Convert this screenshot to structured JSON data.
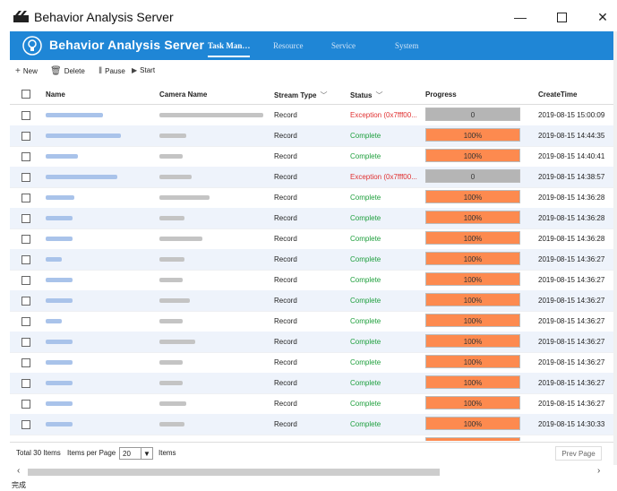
{
  "window": {
    "title": "Behavior Analysis Server"
  },
  "header": {
    "app_name": "Behavior Analysis Server",
    "tabs": [
      {
        "label": "Task Man…",
        "active": true
      },
      {
        "label": "Resource",
        "active": false
      },
      {
        "label": "Service",
        "active": false
      },
      {
        "label": "System",
        "active": false
      }
    ]
  },
  "toolbar": {
    "new_label": "New",
    "delete_label": "Delete",
    "pause_label": "Pause",
    "start_label": "Start"
  },
  "table": {
    "columns": [
      "Name",
      "Camera Name",
      "Stream Type",
      "Status",
      "Progress",
      "CreateTime"
    ],
    "rows": [
      {
        "stream": "Record",
        "status": "Exception (0x7fff00...",
        "status_type": "error",
        "progress": "0",
        "time": "2019-08-15 15:00:09"
      },
      {
        "stream": "Record",
        "status": "Complete",
        "status_type": "ok",
        "progress": "100%",
        "time": "2019-08-15 14:44:35"
      },
      {
        "stream": "Record",
        "status": "Complete",
        "status_type": "ok",
        "progress": "100%",
        "time": "2019-08-15 14:40:41"
      },
      {
        "stream": "Record",
        "status": "Exception (0x7fff00...",
        "status_type": "error",
        "progress": "0",
        "time": "2019-08-15 14:38:57"
      },
      {
        "stream": "Record",
        "status": "Complete",
        "status_type": "ok",
        "progress": "100%",
        "time": "2019-08-15 14:36:28"
      },
      {
        "stream": "Record",
        "status": "Complete",
        "status_type": "ok",
        "progress": "100%",
        "time": "2019-08-15 14:36:28"
      },
      {
        "stream": "Record",
        "status": "Complete",
        "status_type": "ok",
        "progress": "100%",
        "time": "2019-08-15 14:36:28"
      },
      {
        "stream": "Record",
        "status": "Complete",
        "status_type": "ok",
        "progress": "100%",
        "time": "2019-08-15 14:36:27"
      },
      {
        "stream": "Record",
        "status": "Complete",
        "status_type": "ok",
        "progress": "100%",
        "time": "2019-08-15 14:36:27"
      },
      {
        "stream": "Record",
        "status": "Complete",
        "status_type": "ok",
        "progress": "100%",
        "time": "2019-08-15 14:36:27"
      },
      {
        "stream": "Record",
        "status": "Complete",
        "status_type": "ok",
        "progress": "100%",
        "time": "2019-08-15 14:36:27"
      },
      {
        "stream": "Record",
        "status": "Complete",
        "status_type": "ok",
        "progress": "100%",
        "time": "2019-08-15 14:36:27"
      },
      {
        "stream": "Record",
        "status": "Complete",
        "status_type": "ok",
        "progress": "100%",
        "time": "2019-08-15 14:36:27"
      },
      {
        "stream": "Record",
        "status": "Complete",
        "status_type": "ok",
        "progress": "100%",
        "time": "2019-08-15 14:36:27"
      },
      {
        "stream": "Record",
        "status": "Complete",
        "status_type": "ok",
        "progress": "100%",
        "time": "2019-08-15 14:36:27"
      },
      {
        "stream": "Record",
        "status": "Complete",
        "status_type": "ok",
        "progress": "100%",
        "time": "2019-08-15 14:30:33"
      },
      {
        "stream": "Record",
        "status": "Complete",
        "status_type": "ok",
        "progress": "100%",
        "time": "2019-08-15 14:30:33"
      }
    ]
  },
  "footer": {
    "total": "Total 30 Items",
    "per_page_label": "Items per Page",
    "per_page_value": "20",
    "items_label": "Items",
    "prev_label": "Prev Page"
  },
  "statusbar": {
    "text": "完成"
  },
  "colors": {
    "accent": "#1f86d6",
    "progress_done": "#fd8a4f",
    "progress_zero": "#b5b5b5",
    "ok": "#1e9f3d",
    "error": "#e03030"
  }
}
